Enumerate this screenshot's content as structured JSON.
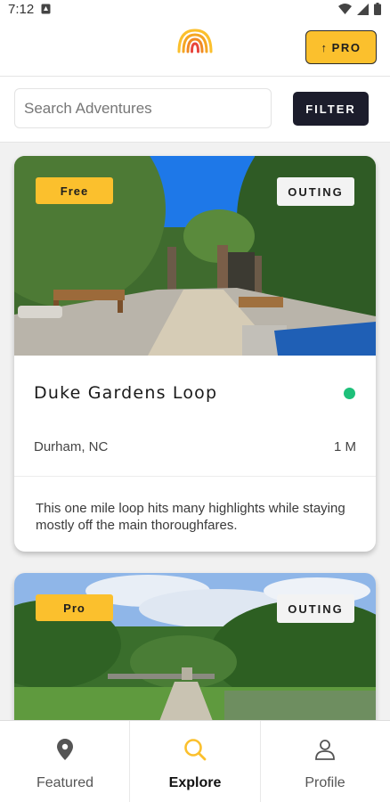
{
  "status_bar": {
    "time": "7:12"
  },
  "header": {
    "pro_button_label": "PRO",
    "pro_arrow": "↑"
  },
  "search": {
    "placeholder": "Search Adventures",
    "value": "",
    "filter_label": "FILTER"
  },
  "cards": [
    {
      "price_badge": "Free",
      "type_badge": "OUTING",
      "title": "Duke Gardens Loop",
      "location": "Durham, NC",
      "distance": "1 M",
      "description": "This one mile loop hits many highlights while staying mostly off the main thoroughfares.",
      "status_color": "#1ec07a"
    },
    {
      "price_badge": "Pro",
      "type_badge": "OUTING"
    }
  ],
  "bottom_nav": [
    {
      "label": "Featured",
      "icon": "location-pin-icon",
      "active": false
    },
    {
      "label": "Explore",
      "icon": "search-icon",
      "active": true
    },
    {
      "label": "Profile",
      "icon": "person-icon",
      "active": false
    }
  ],
  "colors": {
    "accent": "#fbc02d",
    "dark": "#1c1d2c",
    "status_green": "#1ec07a"
  }
}
